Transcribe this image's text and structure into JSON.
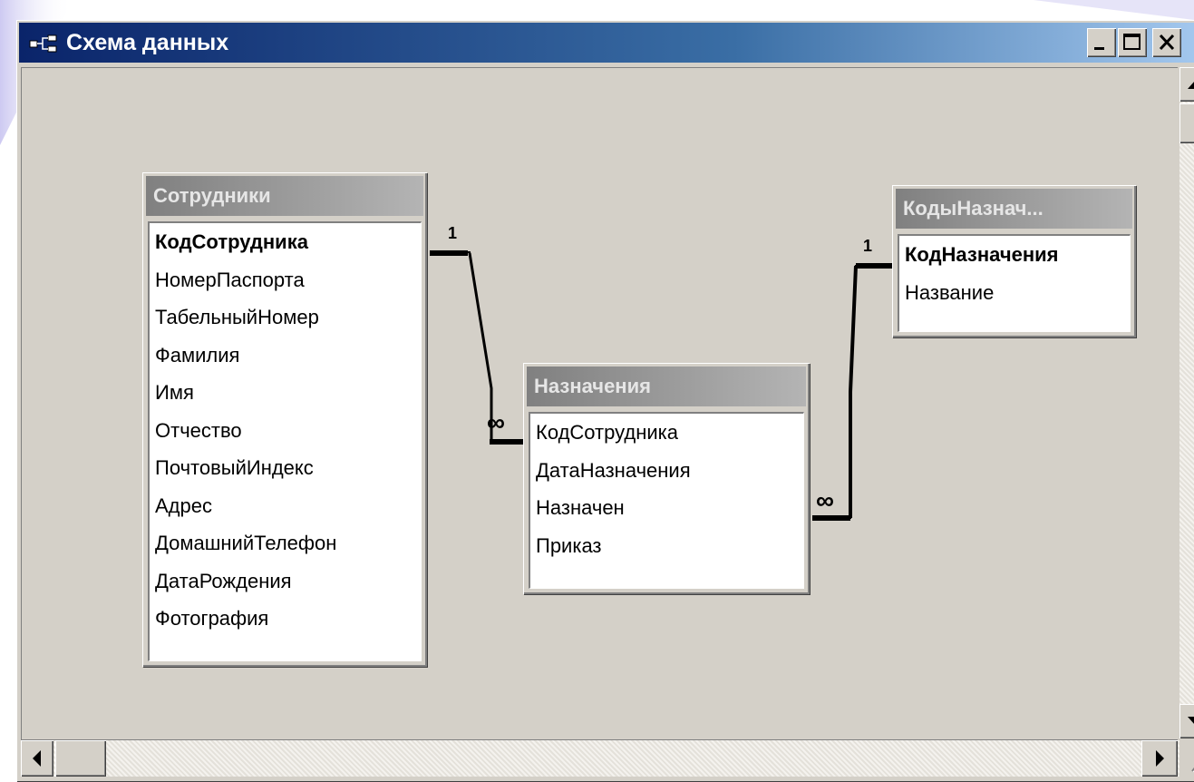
{
  "window": {
    "title": "Схема данных"
  },
  "tables": [
    {
      "name": "Сотрудники",
      "fields": [
        {
          "label": "КодСотрудника",
          "key": true
        },
        {
          "label": "НомерПаспорта",
          "key": false
        },
        {
          "label": "ТабельныйНомер",
          "key": false
        },
        {
          "label": "Фамилия",
          "key": false
        },
        {
          "label": "Имя",
          "key": false
        },
        {
          "label": "Отчество",
          "key": false
        },
        {
          "label": "ПочтовыйИндекс",
          "key": false
        },
        {
          "label": "Адрес",
          "key": false
        },
        {
          "label": "ДомашнийТелефон",
          "key": false
        },
        {
          "label": "ДатаРождения",
          "key": false
        },
        {
          "label": "Фотография",
          "key": false
        }
      ]
    },
    {
      "name": "Назначения",
      "fields": [
        {
          "label": "КодСотрудника",
          "key": false
        },
        {
          "label": "ДатаНазначения",
          "key": false
        },
        {
          "label": "Назначен",
          "key": false
        },
        {
          "label": "Приказ",
          "key": false
        }
      ]
    },
    {
      "name": "КодыНазнач...",
      "fields": [
        {
          "label": "КодНазначения",
          "key": true
        },
        {
          "label": "Название",
          "key": false
        }
      ]
    }
  ],
  "relationships": [
    {
      "from_table": "Сотрудники",
      "from_field": "КодСотрудника",
      "one_label": "1",
      "to_table": "Назначения",
      "to_field": "КодСотрудника",
      "many_label": "∞"
    },
    {
      "from_table": "КодыНазнач...",
      "from_field": "КодНазначения",
      "one_label": "1",
      "to_table": "Назначения",
      "to_field": "Назначен",
      "many_label": "∞"
    }
  ],
  "icons": {
    "app": "relationships-icon",
    "minimize": "minimize-icon",
    "maximize": "maximize-icon",
    "close": "close-icon",
    "scroll_up": "arrow-up-icon",
    "scroll_down": "arrow-down-icon",
    "scroll_left": "arrow-left-icon",
    "scroll_right": "arrow-right-icon"
  },
  "colors": {
    "titlebar_start": "#0a246a",
    "titlebar_end": "#a6caf0",
    "window_face": "#d4d0c8",
    "table_title": "#808080"
  }
}
